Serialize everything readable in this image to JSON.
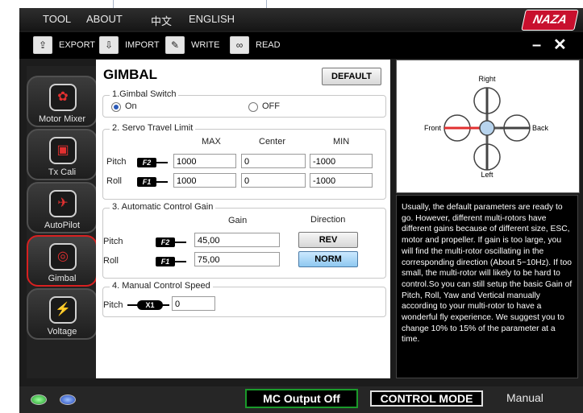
{
  "menu": {
    "tool": "TOOL",
    "about": "ABOUT",
    "chinese": "中文",
    "english": "ENGLISH"
  },
  "logo": "NAZA",
  "toolbar": {
    "export": "EXPORT",
    "import": "IMPORT",
    "write": "WRITE",
    "read": "READ"
  },
  "nav": [
    {
      "label": "Motor Mixer",
      "icon": "propeller-icon"
    },
    {
      "label": "Tx Cali",
      "icon": "transmitter-icon"
    },
    {
      "label": "AutoPilot",
      "icon": "satellite-icon"
    },
    {
      "label": "Gimbal",
      "icon": "gimbal-icon"
    },
    {
      "label": "Voltage",
      "icon": "battery-icon"
    }
  ],
  "page": {
    "title": "GIMBAL",
    "default_button": "DEFAULT"
  },
  "gimbal_switch": {
    "legend": "1.Gimbal Switch",
    "on_label": "On",
    "off_label": "OFF",
    "selected": "On"
  },
  "servo": {
    "legend": "2. Servo Travel Limit",
    "headers": {
      "max": "MAX",
      "center": "Center",
      "min": "MIN"
    },
    "rows": [
      {
        "label": "Pitch",
        "channel": "F2",
        "max": "1000",
        "center": "0",
        "min": "-1000"
      },
      {
        "label": "Roll",
        "channel": "F1",
        "max": "1000",
        "center": "0",
        "min": "-1000"
      }
    ]
  },
  "gain": {
    "legend": "3. Automatic Control Gain",
    "headers": {
      "gain": "Gain",
      "direction": "Direction"
    },
    "rows": [
      {
        "label": "Pitch",
        "channel": "F2",
        "gain": "45,00",
        "direction": "REV"
      },
      {
        "label": "Roll",
        "channel": "F1",
        "gain": "75,00",
        "direction": "NORM"
      }
    ]
  },
  "manual_speed": {
    "legend": "4. Manual Control Speed",
    "label": "Pitch",
    "channel": "X1",
    "value": "0"
  },
  "diagram": {
    "right": "Right",
    "front": "Front",
    "back": "Back",
    "left": "Left"
  },
  "info_text": "Usually, the default parameters are ready to go. However, different multi-rotors have different gains because of different size, ESC, motor and propeller. If gain is too large, you will find the multi-rotor oscillating in the corresponding direction (About 5~10Hz). If too small, the multi-rotor will likely to be hard to control.So you can still setup the basic Gain of Pitch, Roll, Yaw and Vertical manually according to your multi-rotor to have a wonderful fly experience. We suggest you to change 10% to 15% of the parameter at a time.",
  "status": {
    "mc_output": "MC Output Off",
    "control_mode_label": "CONTROL MODE",
    "control_mode_value": "Manual"
  },
  "colors": {
    "accent_red": "#d82020",
    "status_green": "#1a9a2a",
    "led_green": "#2fbf3a",
    "led_blue": "#2f5fdf"
  }
}
